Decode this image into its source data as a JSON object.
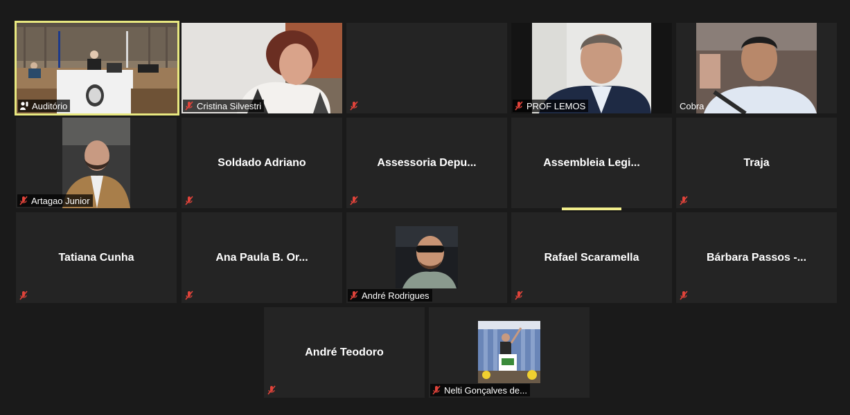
{
  "participants": [
    {
      "name": "Auditório",
      "type": "video",
      "active": true,
      "muted": false
    },
    {
      "name": "Cristina Silvestri",
      "type": "video",
      "muted": true
    },
    {
      "name": "",
      "type": "blank",
      "muted": true
    },
    {
      "name": "PROF LEMOS",
      "type": "video",
      "muted": true
    },
    {
      "name": "Cobra",
      "type": "video",
      "muted": false
    },
    {
      "name": "Artagao Junior",
      "type": "video",
      "muted": true
    },
    {
      "name": "Soldado Adriano",
      "type": "name",
      "muted": true
    },
    {
      "name": "Assessoria Depu...",
      "type": "name",
      "muted": true
    },
    {
      "name": "Assembleia Legi...",
      "type": "name",
      "muted": false,
      "speaking": true
    },
    {
      "name": "Traja",
      "type": "name",
      "muted": true
    },
    {
      "name": "Tatiana Cunha",
      "type": "name",
      "muted": true
    },
    {
      "name": "Ana Paula B. Or...",
      "type": "name",
      "muted": true
    },
    {
      "name": "André Rodrigues",
      "type": "video",
      "muted": true
    },
    {
      "name": "Rafael Scaramella",
      "type": "name",
      "muted": true
    },
    {
      "name": "Bárbara Passos -...",
      "type": "name",
      "muted": true
    },
    {
      "name": "André Teodoro",
      "type": "name",
      "muted": true
    },
    {
      "name": "Nelti Gonçalves de...",
      "type": "video",
      "muted": true
    }
  ],
  "icons": {
    "muted": "muted-mic-icon",
    "spotlight": "person-pin-icon"
  },
  "colors": {
    "active_border": "#e8e880",
    "mute_red": "#e0433a",
    "speaking_bar": "#f2ee8c"
  }
}
